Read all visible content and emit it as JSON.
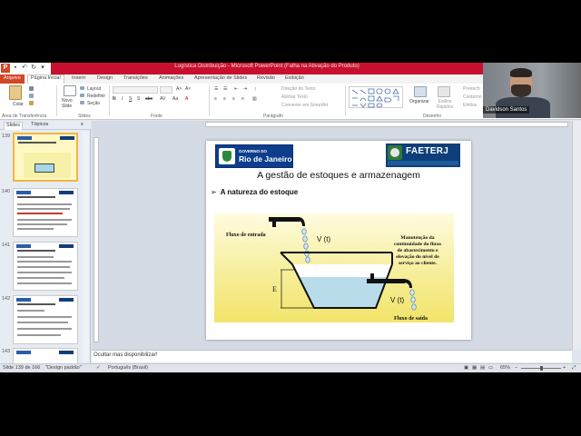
{
  "window": {
    "title": "Logística Distribuição - Microsoft PowerPoint (Falha na Ativação do Produto)",
    "app_letter": "P"
  },
  "tabs": [
    "Arquivo",
    "Página Inicial",
    "Inserir",
    "Design",
    "Transições",
    "Animações",
    "Apresentação de Slides",
    "Revisão",
    "Exibição"
  ],
  "ribbon": {
    "paste": "Colar",
    "new_slide": "Novo Slide",
    "layout": "Layout",
    "reset": "Redefinir",
    "section": "Seção",
    "text_direction": "Direção do Texto",
    "align_text": "Alinhar Texto",
    "convert_smartart": "Converter em SmartArt",
    "arrange": "Organizar",
    "quick_styles": "Estilos Rápidos",
    "fill": "Preench",
    "outline": "Contorno",
    "effects": "Efeitos",
    "groups": [
      "Área de Transferência",
      "Slides",
      "Fonte",
      "Parágrafo",
      "Desenho"
    ]
  },
  "webcam": {
    "name": "Davidson Santos"
  },
  "panel": {
    "tabs": [
      "Slides",
      "Tópicos"
    ],
    "close": "x",
    "thumbs": [
      {
        "num": "139",
        "title": "A gestão de estoques e armazenagem",
        "selected": true
      },
      {
        "num": "140",
        "title": "A gestão de estoques e armazenagem",
        "selected": false
      },
      {
        "num": "141",
        "title": "A gestão de estoques e armazenagem",
        "selected": false
      },
      {
        "num": "142",
        "title": "A gestão de estoques e armazenagem",
        "selected": false
      },
      {
        "num": "143",
        "title": "",
        "selected": false
      }
    ]
  },
  "slide": {
    "gov_small": "GOVERNO DO",
    "gov_big": "Rio de Janeiro",
    "faetec_brand": "FAETERJ",
    "title": "A gestão de estoques e armazenagem",
    "bullet": "A natureza do estoque",
    "diagram": {
      "inflow_label": "Fluxo de entrada",
      "outflow_label": "Fluxo de saída",
      "v_in": "V (t)",
      "v_out": "V (t)",
      "e_label": "E",
      "caption_lines": [
        "Manutenção da",
        "continuidade do fluxo",
        "de abastecimento e",
        "elevação  do nível de",
        "serviço ao cliente."
      ]
    }
  },
  "notes": {
    "text": "Ocultar mas disponibilizar!"
  },
  "status": {
    "slide_of": "Slide 139 de 166",
    "theme": "\"Design padrão\"",
    "language": "Português (Brasil)",
    "zoom": "65%",
    "zoom_fraction": 0.5
  },
  "colors": {
    "accent": "#d24726",
    "title_bar": "#c8102e",
    "selection": "#f3b63f",
    "gov_blue": "#0d3d8c"
  }
}
